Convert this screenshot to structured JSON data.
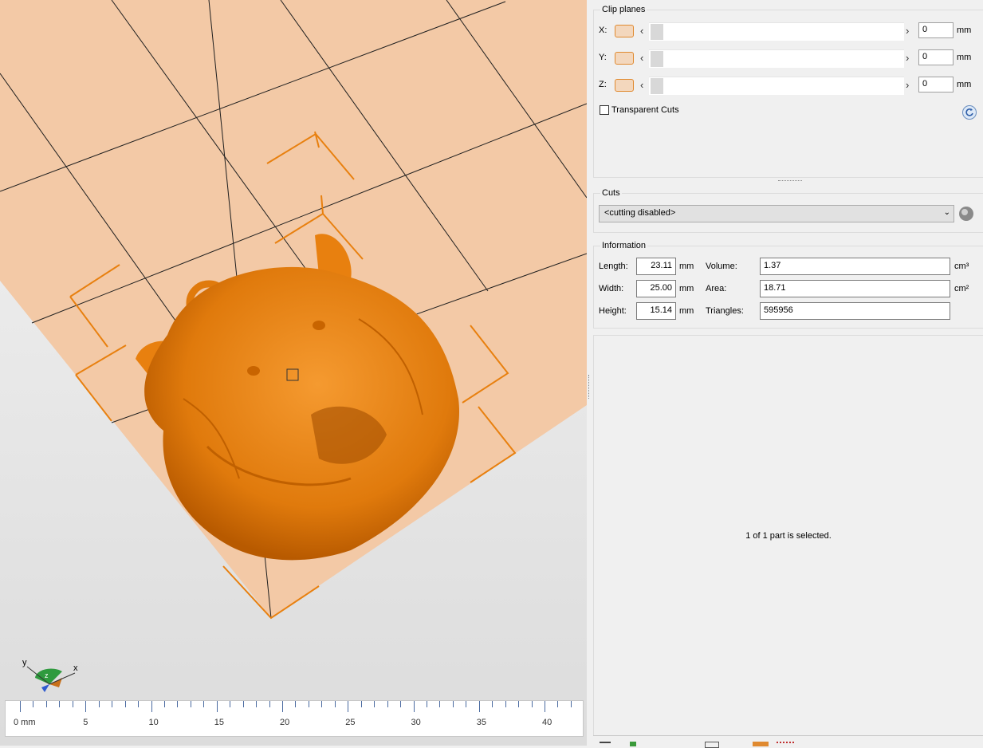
{
  "viewport": {
    "ruler": {
      "unit_label": "0 mm",
      "labels": [
        "5",
        "10",
        "15",
        "20",
        "25",
        "30",
        "35",
        "40"
      ]
    },
    "axis_gizmo": {
      "x_label": "x",
      "y_label": "y",
      "z_label": "z"
    }
  },
  "clip_planes": {
    "title": "Clip planes",
    "rows": [
      {
        "axis": "X:",
        "value": "0",
        "unit": "mm"
      },
      {
        "axis": "Y:",
        "value": "0",
        "unit": "mm"
      },
      {
        "axis": "Z:",
        "value": "0",
        "unit": "mm"
      }
    ],
    "transparent_cuts_label": "Transparent Cuts",
    "transparent_cuts_checked": false
  },
  "cuts": {
    "title": "Cuts",
    "selected": "<cutting disabled>"
  },
  "information": {
    "title": "Information",
    "length_label": "Length:",
    "length_value": "23.11",
    "length_unit": "mm",
    "width_label": "Width:",
    "width_value": "25.00",
    "width_unit": "mm",
    "height_label": "Height:",
    "height_value": "15.14",
    "height_unit": "mm",
    "volume_label": "Volume:",
    "volume_value": "1.37",
    "volume_unit": "cm³",
    "area_label": "Area:",
    "area_value": "18.71",
    "area_unit": "cm²",
    "triangles_label": "Triangles:",
    "triangles_value": "595956"
  },
  "status": {
    "selection_text": "1 of 1 part is selected."
  },
  "colors": {
    "model": "#e8800f",
    "plate": "#f3c9a6",
    "accent": "#e08a30"
  }
}
